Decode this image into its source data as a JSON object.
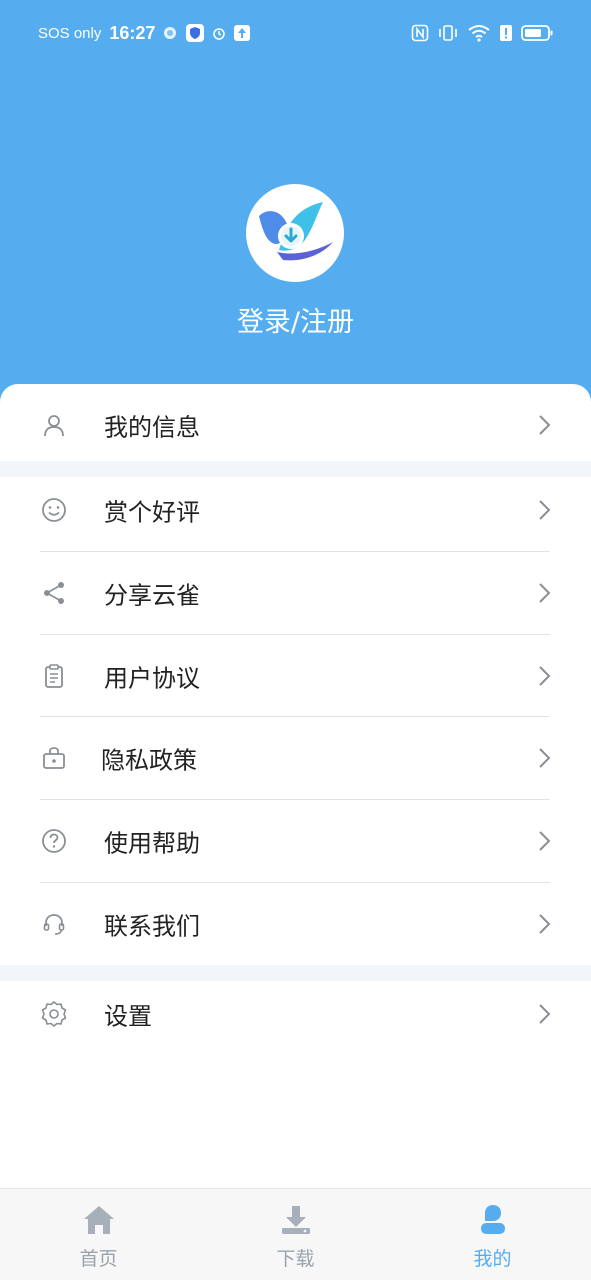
{
  "status_bar": {
    "carrier": "SOS only",
    "time": "16:27",
    "left_icons": [
      "weather-icon",
      "shield-icon",
      "alarm-icon",
      "upload-icon"
    ],
    "right_icons": [
      "nfc-icon",
      "vibrate-icon",
      "wifi-icon",
      "sim-alert-icon",
      "battery-icon"
    ]
  },
  "profile": {
    "avatar_icon": "app-logo-bird-download-icon",
    "login_label": "登录/注册"
  },
  "menu": {
    "my_info": "我的信息",
    "rate": "赏个好评",
    "share": "分享云雀",
    "agreement": "用户协议",
    "privacy": "隐私政策",
    "help": "使用帮助",
    "contact": "联系我们",
    "settings": "设置"
  },
  "bottom_nav": {
    "home": "首页",
    "download": "下载",
    "mine": "我的",
    "active": "mine"
  },
  "colors": {
    "accent": "#55adf0",
    "icon_gray": "#8a8f95",
    "text": "#222222",
    "nav_inactive": "#9aa3ad"
  }
}
